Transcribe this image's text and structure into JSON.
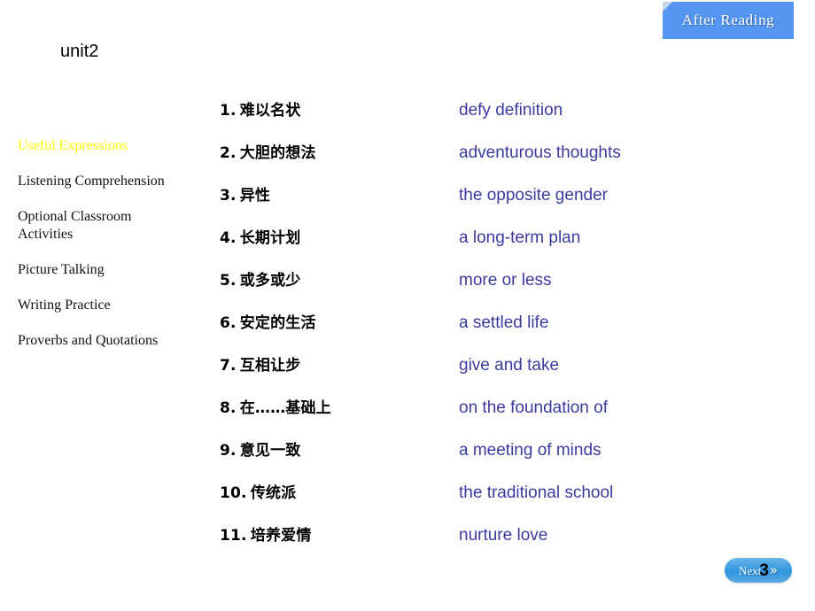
{
  "header": {
    "banner_title": "After Reading",
    "banner_color": "#5596f2"
  },
  "unit": {
    "title": "unit2"
  },
  "sidebar": {
    "active_color": "#FFFF00",
    "items": [
      {
        "label": "Useful Expressions",
        "active": true
      },
      {
        "label": "Listening Comprehension",
        "active": false
      },
      {
        "label": "Optional Classroom\nActivities",
        "active": false
      },
      {
        "label": "Picture Talking",
        "active": false
      },
      {
        "label": "Writing Practice",
        "active": false
      },
      {
        "label": "Proverbs and Quotations",
        "active": false
      }
    ]
  },
  "main": {
    "text_color_english": "#3b3b9e",
    "expressions": [
      {
        "num": "1.",
        "chinese": "难以名状",
        "english": "defy definition"
      },
      {
        "num": "2.",
        "chinese": "大胆的想法",
        "english": "adventurous thoughts"
      },
      {
        "num": "3.",
        "chinese": "异性",
        "english": "the opposite gender"
      },
      {
        "num": "4.",
        "chinese": "长期计划",
        "english": "a long-term plan"
      },
      {
        "num": "5.",
        "chinese": "或多或少",
        "english": "more or less"
      },
      {
        "num": "6.",
        "chinese": "安定的生活",
        "english": "a settled life"
      },
      {
        "num": "7.",
        "chinese": "互相让步",
        "english": "give and take"
      },
      {
        "num": "8.",
        "chinese": "在……基础上",
        "english": "on the foundation of"
      },
      {
        "num": "9.",
        "chinese": "意见一致",
        "english": "a meeting of minds"
      },
      {
        "num": "10.",
        "chinese": "传统派",
        "english": "the traditional school"
      },
      {
        "num": "11.",
        "chinese": "培养爱情",
        "english": "nurture love"
      }
    ]
  },
  "footer": {
    "next_label": "Next",
    "page_number": "3",
    "next_arrow": "»"
  }
}
